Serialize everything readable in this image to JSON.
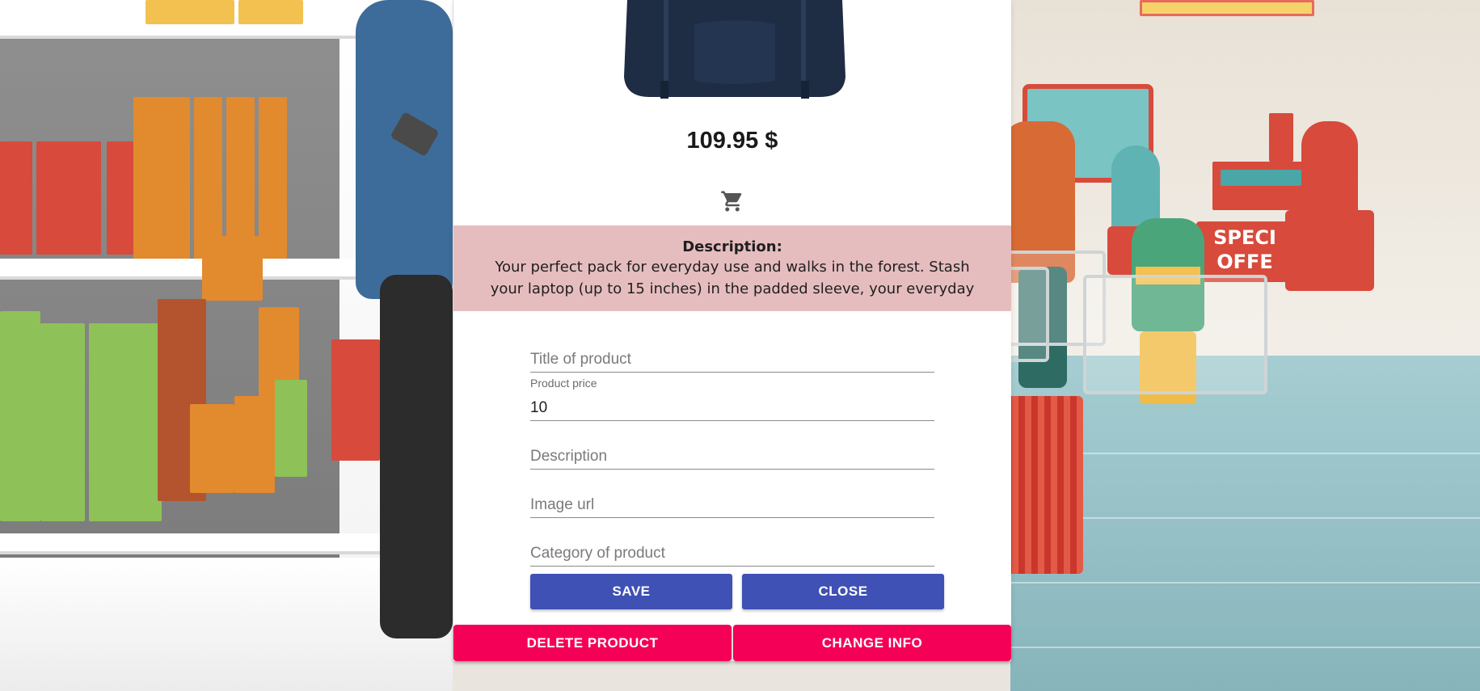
{
  "product": {
    "price": "109.95 $",
    "description_heading": "Description:",
    "description_text": "Your perfect pack for everyday use and walks in the forest. Stash your laptop (up to 15 inches) in the padded sleeve, your everyday",
    "image_icon": "backpack-image",
    "cart_icon": "shopping-cart-icon"
  },
  "form": {
    "title_placeholder": "Title of product",
    "price_label": "Product price",
    "price_value": "10",
    "description_placeholder": "Description",
    "image_url_placeholder": "Image url",
    "category_placeholder": "Category of product"
  },
  "buttons": {
    "save": "SAVE",
    "close": "CLOSE",
    "delete": "DELETE PRODUCT",
    "change": "CHANGE INFO"
  },
  "colors": {
    "primary": "#3f51b5",
    "accent": "#f50057",
    "description_bg": "#e6bdbf"
  }
}
